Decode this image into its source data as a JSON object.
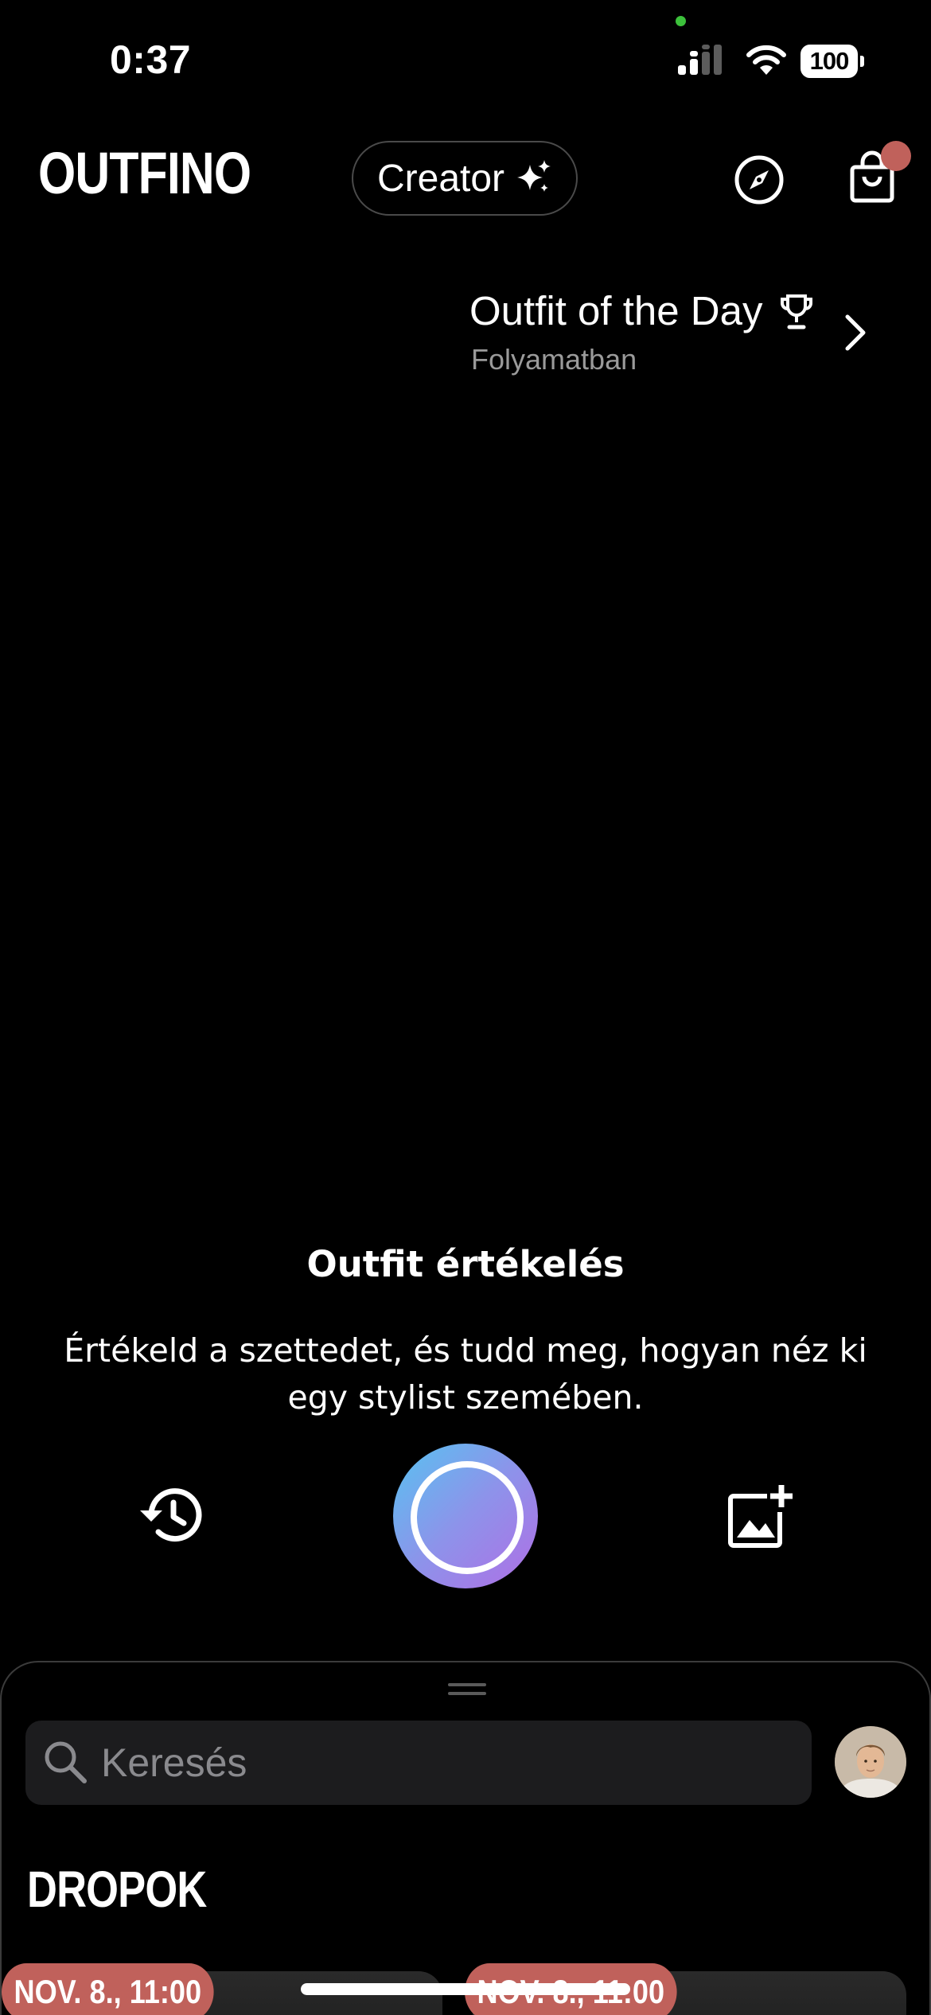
{
  "status_bar": {
    "time": "0:37",
    "battery": "100",
    "icons": [
      "signal-icon",
      "wifi-icon",
      "battery-icon"
    ]
  },
  "header": {
    "brand": "OUTFINO",
    "creator_label": "Creator",
    "icons": [
      "sparkles-icon",
      "compass-icon",
      "cart-icon"
    ],
    "cart_badge_color": "#c0615b"
  },
  "outfit_of_the_day": {
    "title": "Outfit of the Day",
    "status": "Folyamatban",
    "icons": [
      "trophy-icon",
      "chevron-right-icon"
    ]
  },
  "rating": {
    "title": "Outfit értékelés",
    "description": "Értékeld a szettedet, és tudd meg, hogyan néz ki egy stylist szemében.",
    "icons": [
      "history-icon",
      "capture-button",
      "add-photo-icon"
    ],
    "gradient": [
      "#57c3f1",
      "#b06ee5"
    ]
  },
  "sheet": {
    "search_placeholder": "Keresés",
    "section_title": "DROPOK",
    "drops": [
      {
        "date": "NOV. 8., 11:00"
      },
      {
        "date": "NOV. 8., 11:00"
      }
    ],
    "badge_color": "#c0615b"
  }
}
